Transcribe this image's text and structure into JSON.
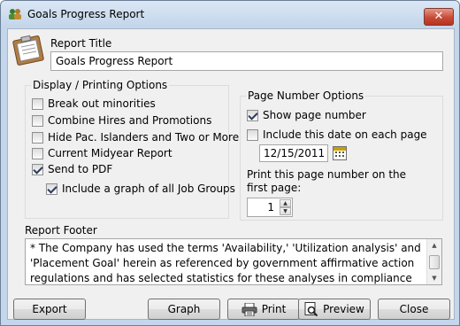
{
  "window": {
    "title": "Goals Progress Report",
    "close_label": "✕"
  },
  "report_title": {
    "label": "Report Title",
    "value": "Goals Progress Report"
  },
  "display_options": {
    "title": "Display / Printing Options",
    "items": [
      {
        "label": "Break out minorities",
        "checked": false
      },
      {
        "label": "Combine Hires and Promotions",
        "checked": false
      },
      {
        "label": "Hide Pac. Islanders and Two or More",
        "checked": false
      },
      {
        "label": "Current Midyear Report",
        "checked": false
      },
      {
        "label": "Send to PDF",
        "checked": true
      },
      {
        "label": "Include a graph of all Job Groups",
        "checked": true
      }
    ]
  },
  "page_number_options": {
    "title": "Page Number Options",
    "show_page_number": {
      "label": "Show page number",
      "checked": true
    },
    "include_date": {
      "label": "Include this date on each page",
      "checked": false
    },
    "date_value": "12/15/2011",
    "first_page_label_line1": "Print this page number on the",
    "first_page_label_line2": "first page:",
    "first_page_value": "1"
  },
  "report_footer": {
    "label": "Report Footer",
    "text": "* The Company has used the terms 'Availability,' 'Utilization analysis' and 'Placement Goal' herein as referenced by government affirmative action regulations and has selected statistics for these analyses in compliance with"
  },
  "buttons": {
    "export": "Export",
    "graph": "Graph",
    "print": "Print",
    "preview": "Preview",
    "close": "Close"
  },
  "icons": {
    "app": "people-icon",
    "clipboard": "clipboard-icon",
    "calendar": "calendar-icon",
    "printer": "printer-icon",
    "preview": "magnifier-document-icon"
  }
}
